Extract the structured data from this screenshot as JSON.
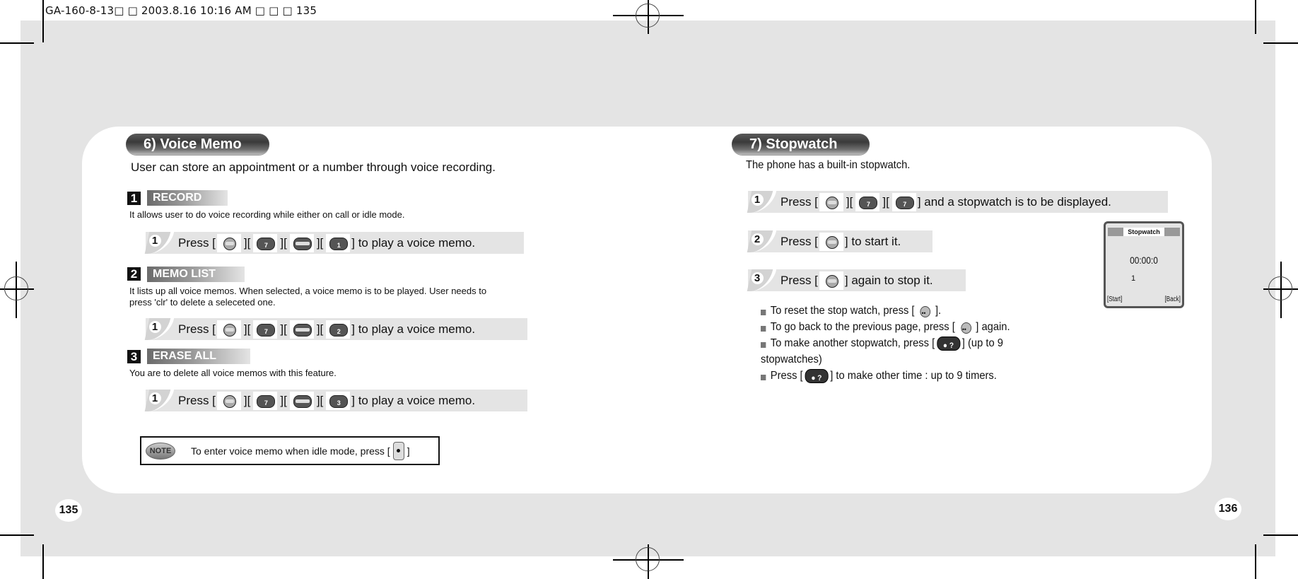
{
  "slug": "GA-160-8-13□ □   2003.8.16 10:16 AM □ □ □ 135",
  "left_page": {
    "section_title": "6) Voice Memo",
    "intro": "User can store an appointment or a number through voice recording.",
    "subsections": [
      {
        "number": "1",
        "label": "RECORD",
        "description": "It allows user to do voice recording while either on call or idle mode.",
        "step": {
          "number": "1",
          "prefix": "Press [",
          "keys": [
            "menu-key",
            "7-key",
            "up-nav-key",
            "1-key"
          ],
          "key_glyphs": [
            "",
            "7",
            "",
            "1"
          ],
          "suffix": "] to play a voice memo."
        }
      },
      {
        "number": "2",
        "label": "MEMO LIST",
        "description_lines": [
          "It lists up all voice memos. When selected, a voice memo is to be played. User needs to",
          "press 'clr' to delete a seleceted one."
        ],
        "step": {
          "number": "1",
          "prefix": "Press [",
          "keys": [
            "menu-key",
            "7-key",
            "up-nav-key",
            "2-key"
          ],
          "key_glyphs": [
            "",
            "7",
            "",
            "2"
          ],
          "suffix": "] to play a voice memo."
        }
      },
      {
        "number": "3",
        "label": "ERASE ALL",
        "description": "You are to delete all voice memos with this feature.",
        "step": {
          "number": "1",
          "prefix": "Press [",
          "keys": [
            "menu-key",
            "7-key",
            "up-nav-key",
            "3-key"
          ],
          "key_glyphs": [
            "",
            "7",
            "",
            "3"
          ],
          "suffix": "] to play a voice memo."
        }
      }
    ],
    "note": {
      "badge": "NOTE",
      "text": "To enter voice memo when idle mode, press [",
      "suffix": "]"
    },
    "page_number": "135"
  },
  "right_page": {
    "section_title": "7) Stopwatch",
    "intro": "The phone has a built-in stopwatch.",
    "steps": [
      {
        "number": "1",
        "prefix": "Press [",
        "keys": [
          "menu-key",
          "7-key",
          "7-key"
        ],
        "key_glyphs": [
          "",
          "7",
          "7"
        ],
        "suffix": "] and a stopwatch is to be displayed."
      },
      {
        "number": "2",
        "prefix": "Press [",
        "keys": [
          "menu-key"
        ],
        "suffix": "] to start it."
      },
      {
        "number": "3",
        "prefix": "Press [",
        "keys": [
          "menu-key"
        ],
        "suffix": "] again to stop it."
      }
    ],
    "bullets": [
      {
        "before": "To reset the stop watch, press [",
        "key": "clear-key",
        "after": "]."
      },
      {
        "before": "To go back to the previous page, press [",
        "key": "clear-key",
        "after": "] again."
      },
      {
        "before": "To make another stopwatch, press [",
        "key": "send-key",
        "after": "] (up to 9",
        "continuation": "stopwatches)"
      },
      {
        "before": "Press [",
        "key": "send-key",
        "after": "] to make other time : up to 9 timers."
      }
    ],
    "phone_screen": {
      "title": "Stopwatch",
      "time": "00:00:0",
      "index": "1",
      "left_softkey": "[Start]",
      "right_softkey": "[Back]"
    },
    "page_number": "136"
  },
  "colors": {
    "background_gray": "#e4e4e4",
    "panel": "#ffffff",
    "text": "#111111",
    "step_bar": "#e4e4e4"
  }
}
